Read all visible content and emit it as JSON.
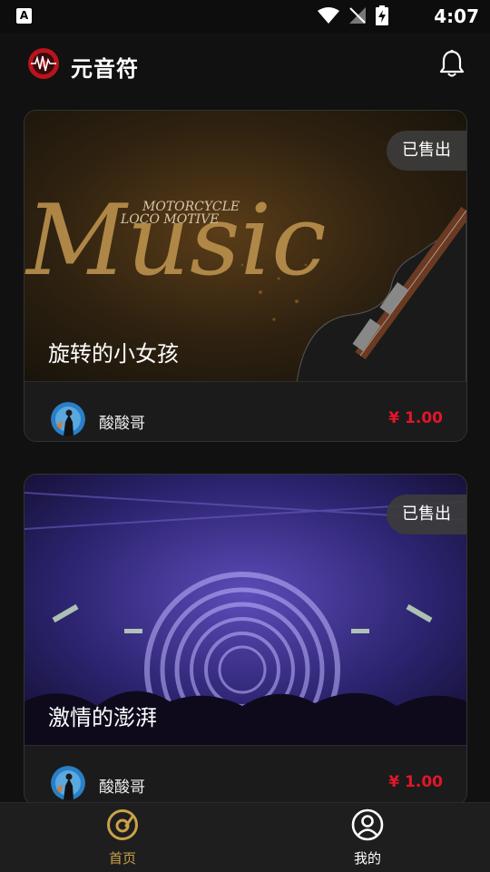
{
  "status_bar": {
    "app_icon_letter": "A",
    "time": "4:07"
  },
  "header": {
    "title": "元音符"
  },
  "colors": {
    "accent": "#c9a24a",
    "price": "#e2162a",
    "background": "#111111"
  },
  "cards": [
    {
      "title": "旋转的小女孩",
      "badge": "已售出",
      "creator": "酸酸哥",
      "price": "¥ 1.00",
      "image_text": {
        "main": "Music",
        "line1": "MOTORCYCLE",
        "line2": "LOCO MOTIVE"
      }
    },
    {
      "title": "激情的澎湃",
      "badge": "已售出",
      "creator": "酸酸哥",
      "price": "¥ 1.00"
    }
  ],
  "tabs": [
    {
      "label": "首页",
      "icon": "home-disc-icon",
      "active": true
    },
    {
      "label": "我的",
      "icon": "profile-icon",
      "active": false
    }
  ]
}
